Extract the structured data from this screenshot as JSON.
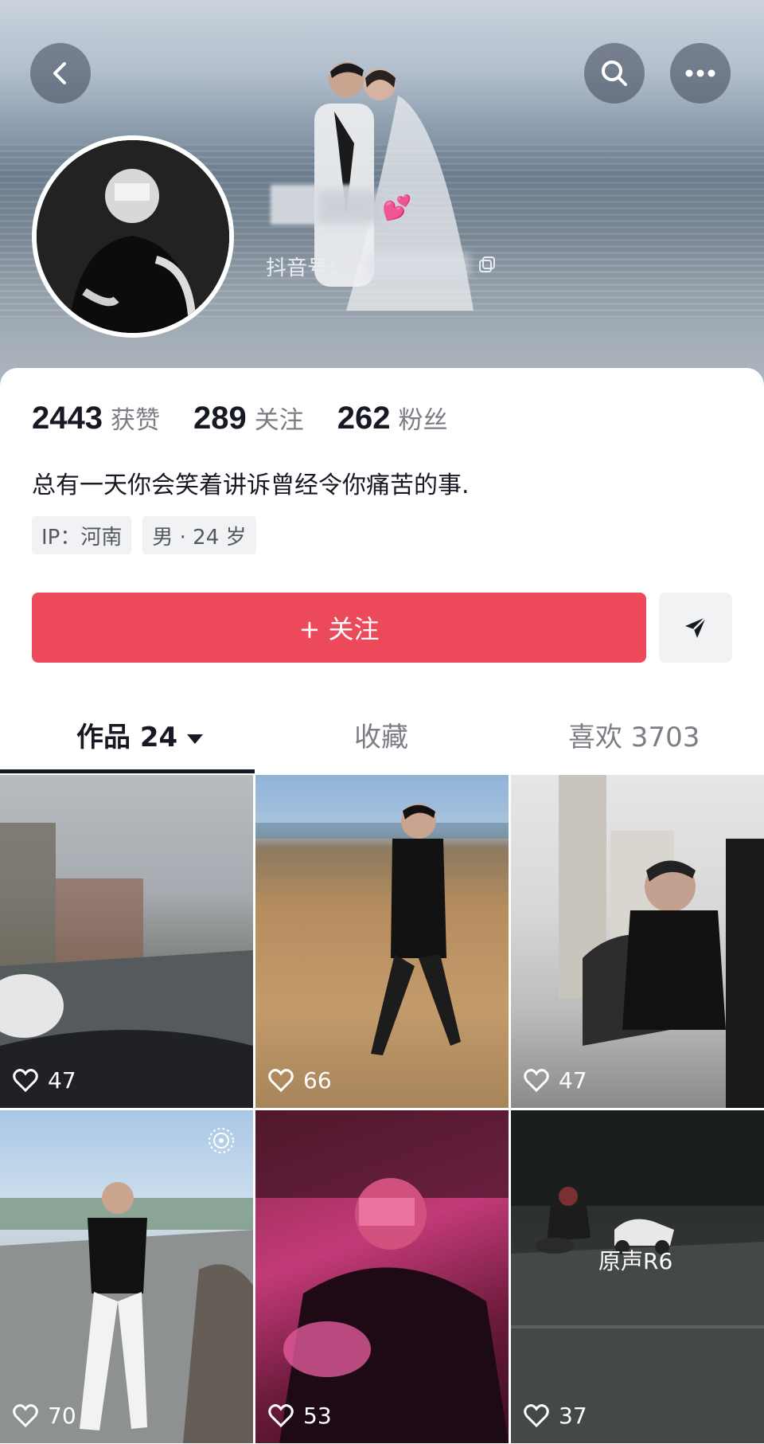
{
  "header": {
    "back_icon": "chevron-left-icon",
    "search_icon": "search-icon",
    "more_icon": "more-horizontal-icon",
    "douyin_id_label": "抖音号：",
    "hearts": "💕"
  },
  "profile": {
    "stats": [
      {
        "value": "2443",
        "label": "获赞"
      },
      {
        "value": "289",
        "label": "关注"
      },
      {
        "value": "262",
        "label": "粉丝"
      }
    ],
    "bio": "总有一天你会笑着讲诉曾经令你痛苦的事.",
    "tags": [
      "IP：河南",
      "男 · 24 岁"
    ],
    "follow_label": "+ 关注",
    "share_icon": "send-icon"
  },
  "tabs": {
    "works": "作品 24",
    "favorites": "收藏",
    "likes": "喜欢 3703"
  },
  "videos": [
    {
      "likes": "47"
    },
    {
      "likes": "66"
    },
    {
      "likes": "47"
    },
    {
      "likes": "70"
    },
    {
      "likes": "53"
    },
    {
      "likes": "37",
      "overlay": "原声R6"
    }
  ],
  "colors": {
    "accent": "#ec4a5a",
    "text_primary": "#161823",
    "text_secondary": "#7c7e85"
  }
}
